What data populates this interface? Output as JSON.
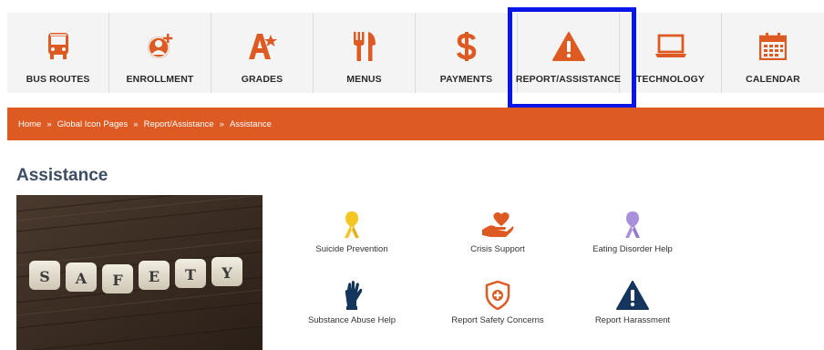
{
  "nav": {
    "items": [
      {
        "label": "BUS ROUTES",
        "icon": "bus-icon"
      },
      {
        "label": "ENROLLMENT",
        "icon": "add-user-icon"
      },
      {
        "label": "GRADES",
        "icon": "grade-icon"
      },
      {
        "label": "MENUS",
        "icon": "utensils-icon"
      },
      {
        "label": "PAYMENTS",
        "icon": "dollar-icon"
      },
      {
        "label": "REPORT/ASSISTANCE",
        "icon": "warning-icon"
      },
      {
        "label": "TECHNOLOGY",
        "icon": "laptop-icon"
      },
      {
        "label": "CALENDAR",
        "icon": "calendar-icon"
      }
    ],
    "active": "REPORT/ASSISTANCE"
  },
  "breadcrumb": {
    "items": [
      "Home",
      "Global Icon Pages",
      "Report/Assistance",
      "Assistance"
    ],
    "separator": "»"
  },
  "page": {
    "title": "Assistance"
  },
  "photo": {
    "tiles": [
      "S",
      "A",
      "F",
      "E",
      "T",
      "Y"
    ]
  },
  "assistance": {
    "items": [
      {
        "label": "Suicide Prevention",
        "icon": "yellow-ribbon-icon"
      },
      {
        "label": "Crisis Support",
        "icon": "heart-hand-icon"
      },
      {
        "label": "Eating Disorder Help",
        "icon": "purple-ribbon-icon"
      },
      {
        "label": "Substance Abuse Help",
        "icon": "raised-hand-icon"
      },
      {
        "label": "Report Safety Concerns",
        "icon": "safety-shield-icon"
      },
      {
        "label": "Report Harassment",
        "icon": "warning-triangle-icon"
      }
    ]
  },
  "colors": {
    "accent": "#dd5a23",
    "highlight": "#0a16e8",
    "title": "#3c4d63",
    "navy": "#14365d",
    "ribbon_yellow": "#f3c623",
    "ribbon_purple": "#a98fdc"
  }
}
